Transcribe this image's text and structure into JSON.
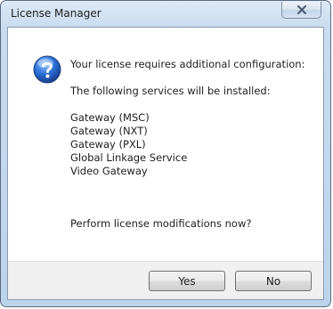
{
  "window": {
    "title": "License Manager"
  },
  "dialog": {
    "icon": "question-icon",
    "line1": "Your license requires additional configuration:",
    "line2": "The following services will be installed:",
    "services": [
      "Gateway (MSC)",
      "Gateway (NXT)",
      "Gateway (PXL)",
      "Global Linkage Service",
      "Video Gateway"
    ],
    "prompt": "Perform license modifications now?"
  },
  "buttons": {
    "yes": "Yes",
    "no": "No"
  },
  "colors": {
    "accent": "#2b6fd6",
    "frame": "#c9dcf0"
  }
}
